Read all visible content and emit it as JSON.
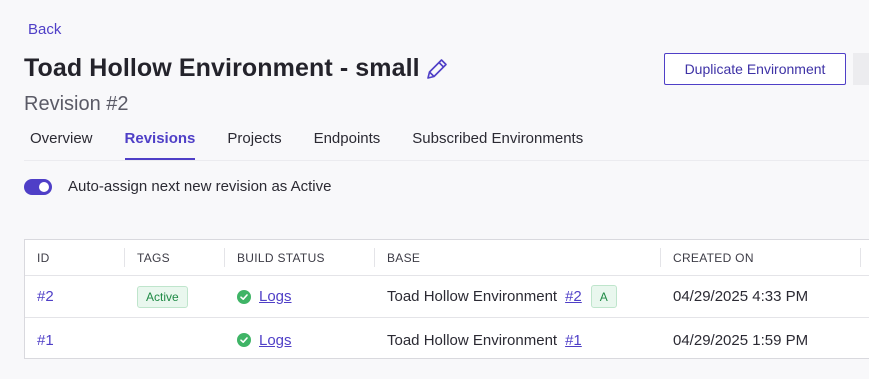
{
  "nav": {
    "back_label": "Back"
  },
  "header": {
    "title": "Toad Hollow Environment - small",
    "revision": "Revision #2",
    "duplicate_label": "Duplicate Environment"
  },
  "tabs": [
    {
      "label": "Overview",
      "active": false
    },
    {
      "label": "Revisions",
      "active": true
    },
    {
      "label": "Projects",
      "active": false
    },
    {
      "label": "Endpoints",
      "active": false
    },
    {
      "label": "Subscribed Environments",
      "active": false
    }
  ],
  "auto_assign": {
    "label": "Auto-assign next new revision as Active",
    "enabled": true
  },
  "table": {
    "columns": [
      "ID",
      "TAGS",
      "BUILD STATUS",
      "BASE",
      "CREATED ON"
    ],
    "rows": [
      {
        "id": "#2",
        "tag": "Active",
        "build_status": "Logs",
        "base_name": "Toad Hollow Environment",
        "base_ref": "#2",
        "base_badge": "A",
        "created_on": "04/29/2025 4:33 PM"
      },
      {
        "id": "#1",
        "tag": "",
        "build_status": "Logs",
        "base_name": "Toad Hollow Environment",
        "base_ref": "#1",
        "base_badge": "",
        "created_on": "04/29/2025 1:59 PM"
      }
    ]
  },
  "colors": {
    "accent": "#4f3fc7",
    "success": "#3fb466",
    "background": "#f8f8fa"
  },
  "icons": {
    "edit": "pencil-icon",
    "status": "check-circle-icon"
  }
}
